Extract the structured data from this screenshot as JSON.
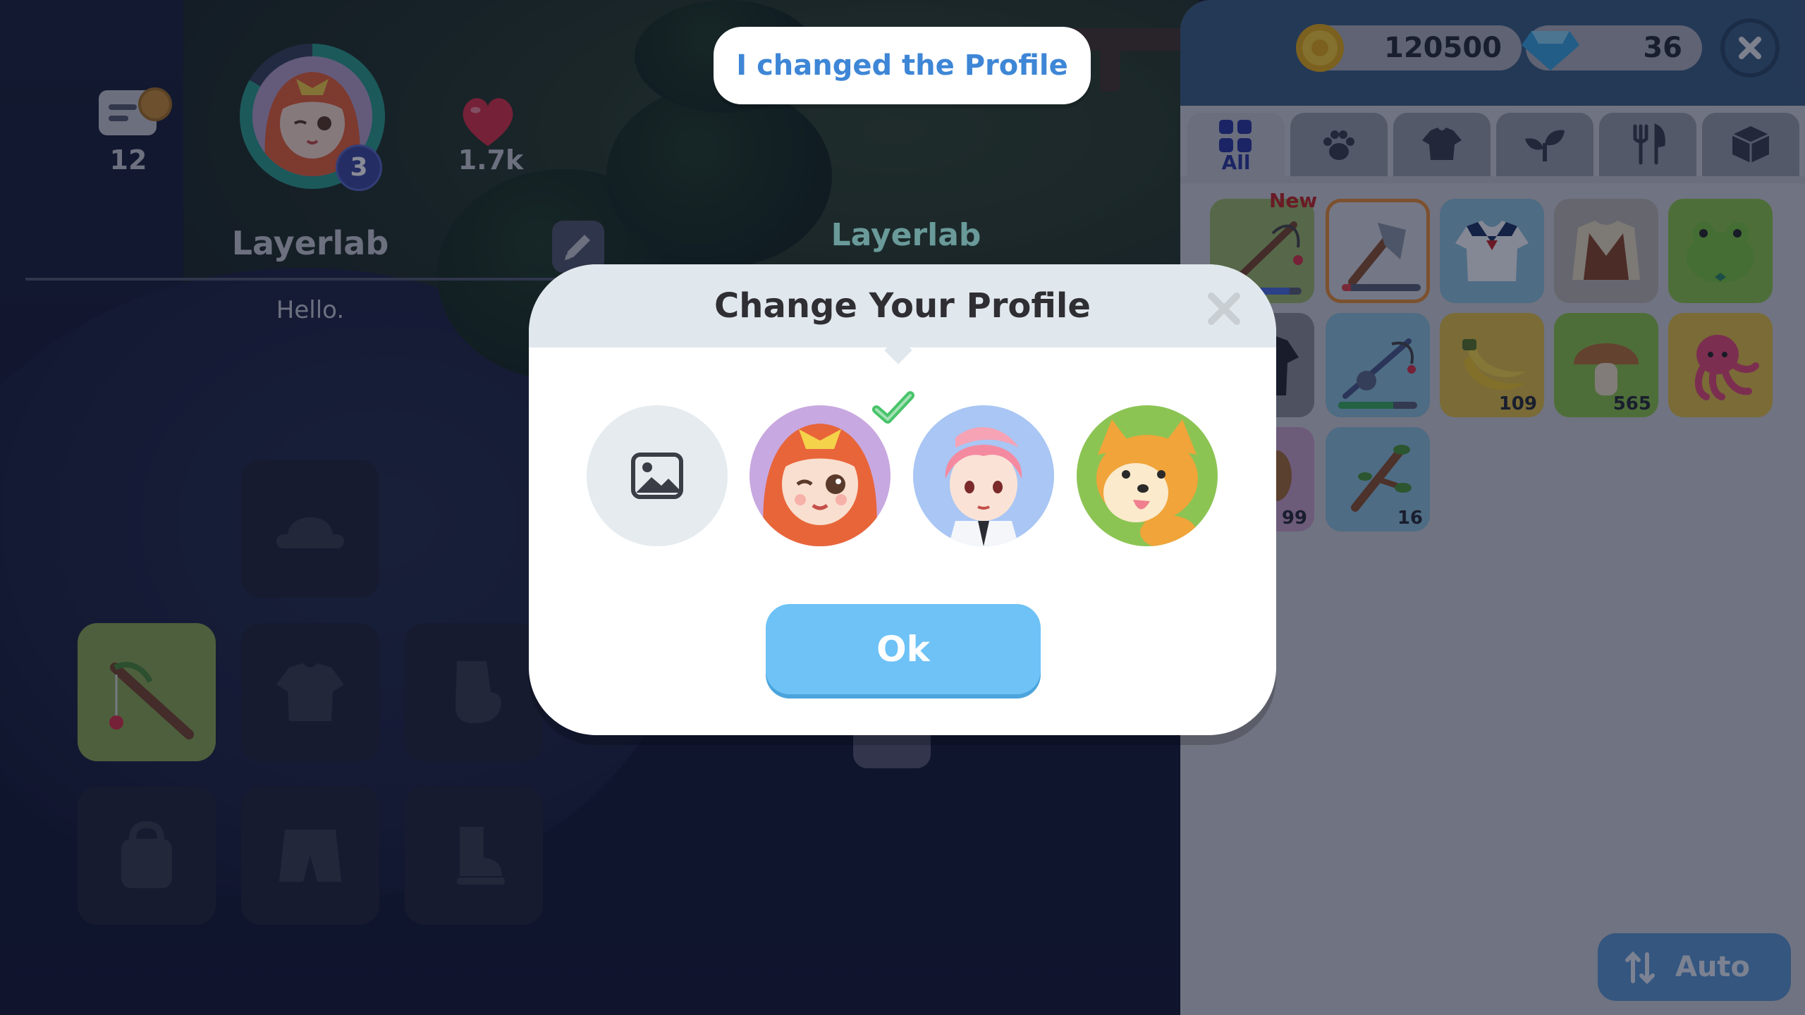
{
  "toast": {
    "text": "I changed the Profile"
  },
  "profile": {
    "letters_count": "12",
    "level": "3",
    "likes": "1.7k",
    "name": "Layerlab",
    "greeting": "Hello."
  },
  "world": {
    "character_name": "Layerlab"
  },
  "equipment_slots": [
    {
      "icon": "hat-icon",
      "active": false
    },
    {
      "icon": "fishing-rod-icon",
      "active": true
    },
    {
      "icon": "shirt-icon",
      "active": false
    },
    {
      "icon": "glove-icon",
      "active": false
    },
    {
      "icon": "bag-icon",
      "active": false
    },
    {
      "icon": "shorts-icon",
      "active": false
    },
    {
      "icon": "boot-icon",
      "active": false
    }
  ],
  "inventory": {
    "coins": "120500",
    "gems": "36",
    "tabs": [
      {
        "label": "All",
        "icon": "grid-icon",
        "active": true
      },
      {
        "label": "",
        "icon": "paw-icon",
        "active": false
      },
      {
        "label": "",
        "icon": "shirt-icon",
        "active": false
      },
      {
        "label": "",
        "icon": "sprout-icon",
        "active": false
      },
      {
        "label": "",
        "icon": "utensils-icon",
        "active": false
      },
      {
        "label": "",
        "icon": "box-icon",
        "active": false
      }
    ],
    "new_badge": "New",
    "items": [
      {
        "name": "fishing-rod",
        "qty": "",
        "durability": 0.85,
        "bar_color": "#4b6fe0"
      },
      {
        "name": "axe",
        "qty": "",
        "durability": 0.12,
        "bar_color": "#e0464b"
      },
      {
        "name": "sailor-shirt",
        "qty": ""
      },
      {
        "name": "vest",
        "qty": ""
      },
      {
        "name": "frog-hat",
        "qty": ""
      },
      {
        "name": "black-jacket",
        "qty": ""
      },
      {
        "name": "reel-rod",
        "qty": "",
        "durability": 0.7,
        "bar_color": "#3cb060"
      },
      {
        "name": "banana",
        "qty": "109"
      },
      {
        "name": "mushroom",
        "qty": "565"
      },
      {
        "name": "octopus",
        "qty": ""
      },
      {
        "name": "wood",
        "qty": "99"
      },
      {
        "name": "branch",
        "qty": "16"
      }
    ],
    "auto_label": "Auto"
  },
  "modal": {
    "title": "Change Your Profile",
    "ok_label": "Ok",
    "options": [
      {
        "icon": "image-icon",
        "selected": false
      },
      {
        "icon": "girl-avatar",
        "selected": true
      },
      {
        "icon": "boy-avatar",
        "selected": false
      },
      {
        "icon": "corgi-avatar",
        "selected": false
      }
    ]
  },
  "colors": {
    "accent_blue": "#6ec2f6",
    "toast_text": "#3e86d6",
    "selected_check": "#48c46a"
  }
}
